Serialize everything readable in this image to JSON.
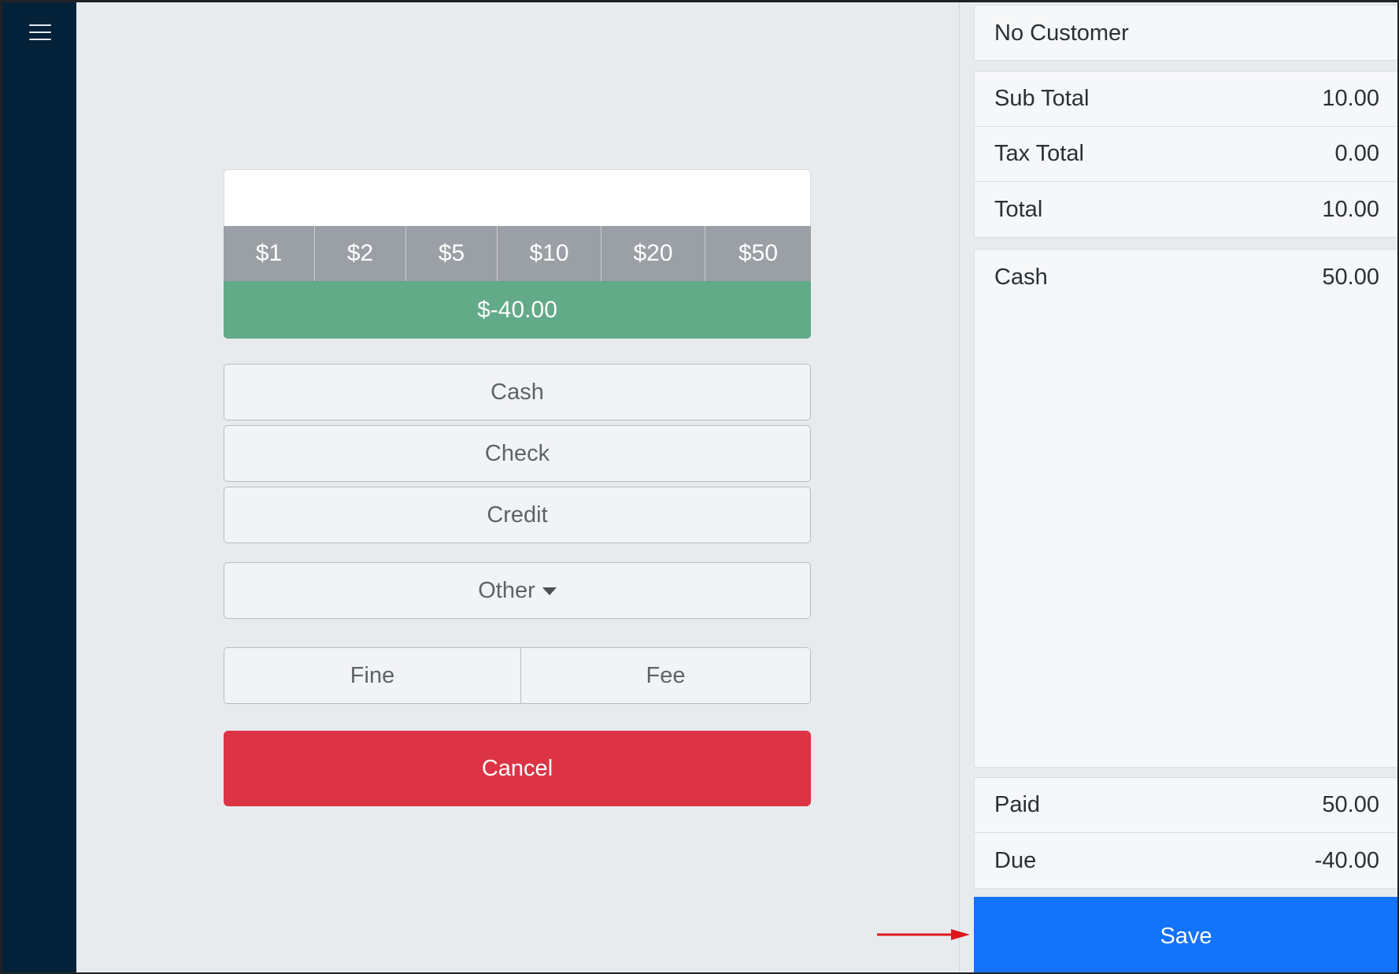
{
  "sidebar": {
    "menu_icon": "hamburger-menu-icon"
  },
  "tender": {
    "amount_value": "",
    "denominations": [
      "$1",
      "$2",
      "$5",
      "$10",
      "$20",
      "$50"
    ],
    "balance": "$-40.00",
    "methods": {
      "cash": "Cash",
      "check": "Check",
      "credit": "Credit"
    },
    "other": "Other",
    "fine": "Fine",
    "fee": "Fee",
    "cancel": "Cancel"
  },
  "summary": {
    "customer": "No Customer",
    "sub_total_label": "Sub Total",
    "sub_total": "10.00",
    "tax_total_label": "Tax Total",
    "tax_total": "0.00",
    "total_label": "Total",
    "total": "10.00",
    "payments": [
      {
        "label": "Cash",
        "amount": "50.00"
      }
    ],
    "paid_label": "Paid",
    "paid": "50.00",
    "due_label": "Due",
    "due": "-40.00",
    "save": "Save"
  },
  "colors": {
    "sidebar": "#03223a",
    "balance": "#62aa88",
    "cancel": "#dc3444",
    "save": "#1373fb",
    "annotation_arrow": "#e0161d"
  }
}
